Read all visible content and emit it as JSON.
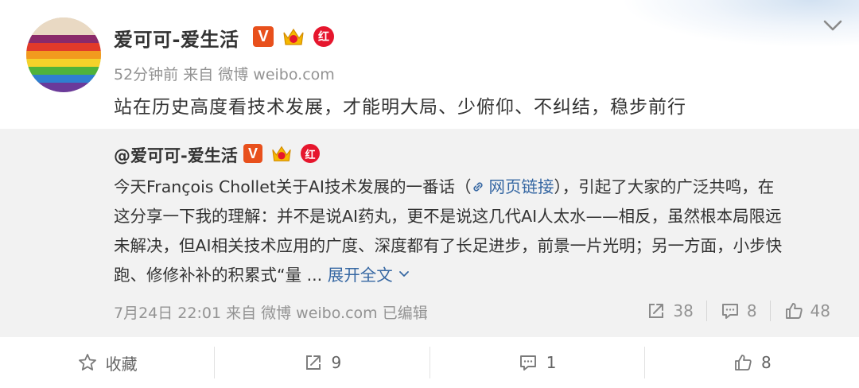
{
  "post": {
    "author": "爱可可-爱生活",
    "meta": "52分钟前 来自 微博 weibo.com",
    "text": "站在历史高度看技术发展，才能明大局、少俯仰、不纠结，稳步前行",
    "badge_v": "V",
    "badge_red": "红"
  },
  "repost": {
    "author": "@爱可可-爱生活",
    "badge_v": "V",
    "badge_red": "红",
    "body": {
      "line1_a": "今天François Chollet关于AI技术发展的一番话（",
      "link_label": "网页链接",
      "line1_b": "），引起了大家的广泛共鸣，在",
      "line2": "这分享一下我的理解：并不是说AI药丸，更不是说这几代AI人太水——相反，虽然根本局限远",
      "line3": "未解决，但AI相关技术应用的广度、深度都有了长足进步，前景一片光明；另一方面，小步快",
      "line4": "跑、修修补补的积累式“量 ... ",
      "expand_label": "展开全文"
    },
    "footer": "7月24日 22:01 来自 微博 weibo.com   已编辑",
    "stats": {
      "reposts": "38",
      "comments": "8",
      "likes": "48"
    }
  },
  "actions": {
    "favorite_label": "收藏",
    "repost_count": "9",
    "comment_count": "1",
    "like_count": "8"
  },
  "colors": {
    "link": "#3768a3",
    "verified_orange": "#e8501c",
    "red_badge": "#e6162d",
    "muted_text": "#939393",
    "repost_bg": "#f2f2f2"
  }
}
